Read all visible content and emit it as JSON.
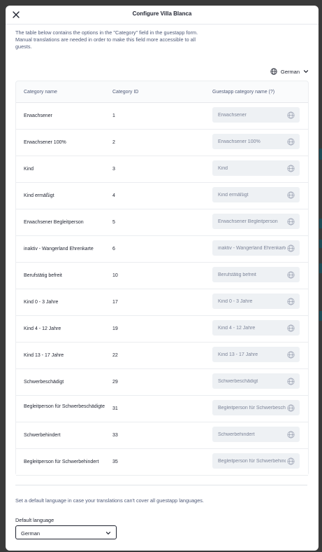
{
  "header": {
    "title": "Configure Villa Blanca",
    "close_icon": "close-icon"
  },
  "intro_text": "The table below contains the options in the \"Category\" field in the guestapp form. Manual translations are needed in order to make this field more accessible to all guests.",
  "language_selector": {
    "value": "German",
    "icon": "globe-icon",
    "chevron": "chevron-down-icon"
  },
  "table": {
    "columns": [
      "Category name",
      "Category ID",
      "Guestapp category name (?)"
    ],
    "rows": [
      {
        "name": "Erwachsener",
        "id": "1",
        "placeholder": "Erwachsener"
      },
      {
        "name": "Erwachsener 100%",
        "id": "2",
        "placeholder": "Erwachsener 100%"
      },
      {
        "name": "Kind",
        "id": "3",
        "placeholder": "Kind"
      },
      {
        "name": "Kind ermäßigt",
        "id": "4",
        "placeholder": "Kind ermäßigt"
      },
      {
        "name": "Erwachsener Begleitperson",
        "id": "5",
        "placeholder": "Erwachsener Begleitperson"
      },
      {
        "name": "inaktiv - Wangerland Ehrenkarte",
        "id": "6",
        "placeholder": "inaktiv - Wangerland Ehrenkarte"
      },
      {
        "name": "Berufstätig befreit",
        "id": "10",
        "placeholder": "Berufstätig befreit"
      },
      {
        "name": "Kind 0 - 3 Jahre",
        "id": "17",
        "placeholder": "Kind 0 - 3 Jahre"
      },
      {
        "name": "Kind 4 - 12 Jahre",
        "id": "19",
        "placeholder": "Kind 4 - 12 Jahre"
      },
      {
        "name": "Kind 13 - 17 Jahre",
        "id": "22",
        "placeholder": "Kind 13 - 17 Jahre"
      },
      {
        "name": "Schwerbeschädigt",
        "id": "29",
        "placeholder": "Schwerbeschädigt"
      },
      {
        "name": "Begleitperson für Schwerbeschädigte",
        "id": "31",
        "placeholder": "Begleitperson für Schwerbeschädigte"
      },
      {
        "name": "Schwerbehindert",
        "id": "33",
        "placeholder": "Schwerbehindert"
      },
      {
        "name": "Begleitperson für Schwerbehindert",
        "id": "35",
        "placeholder": "Begleitperson für Schwerbehindert"
      }
    ]
  },
  "default_language": {
    "note": "Set a default language in case your translations can't cover all guestapp languages.",
    "label": "Default language",
    "value": "German"
  },
  "colors": {
    "primary_text": "#1f2330",
    "secondary_text": "#4f5a78",
    "field_bg": "#eef1f4",
    "backdrop": "#3a3a3a"
  }
}
